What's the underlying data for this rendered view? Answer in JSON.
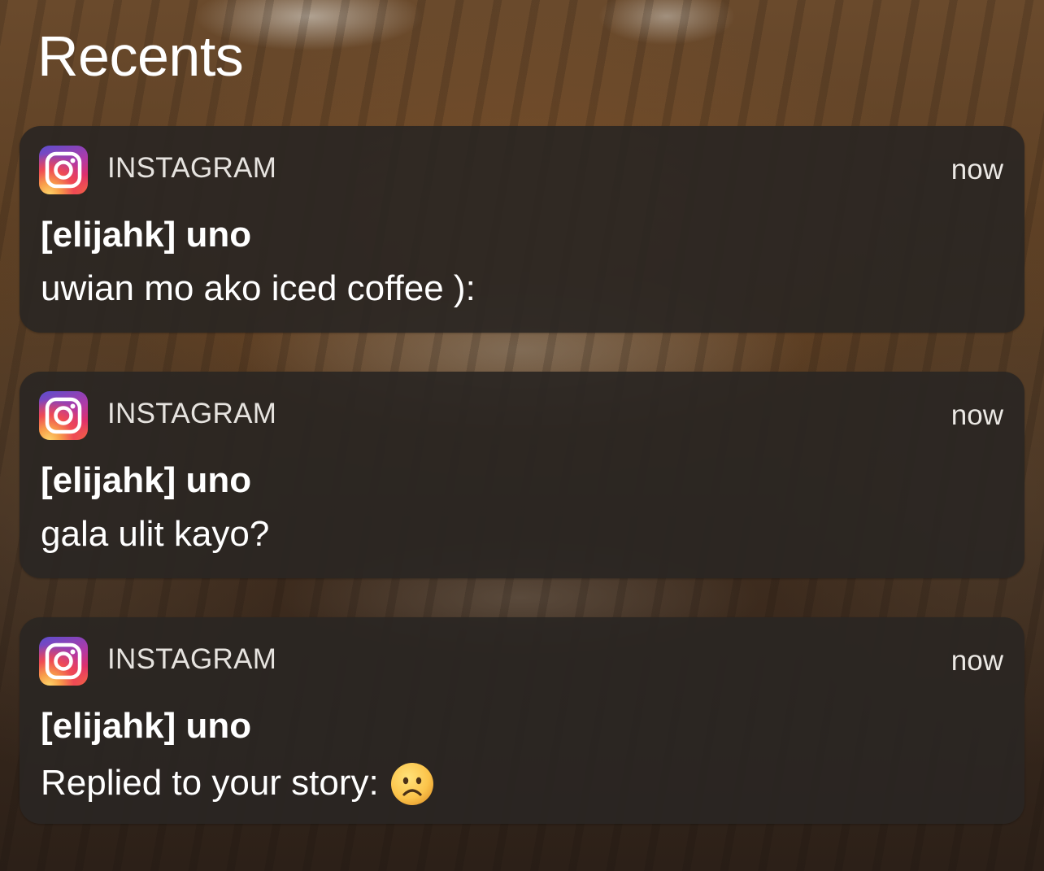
{
  "header": {
    "title": "Recents"
  },
  "notifications": [
    {
      "app_name": "INSTAGRAM",
      "app_icon": "instagram-icon",
      "time": "now",
      "sender": "[elijahk] uno",
      "message": "uwian mo ako iced coffee ):"
    },
    {
      "app_name": "INSTAGRAM",
      "app_icon": "instagram-icon",
      "time": "now",
      "sender": "[elijahk] uno",
      "message": "gala ulit kayo?"
    },
    {
      "app_name": "INSTAGRAM",
      "app_icon": "instagram-icon",
      "time": "now",
      "sender": "[elijahk] uno",
      "message": "Replied to your story:",
      "emoji": "frowning-face-emoji"
    }
  ],
  "colors": {
    "card_background": "#2a2623",
    "text_primary": "#ffffff",
    "text_secondary": "#e6e3df"
  }
}
